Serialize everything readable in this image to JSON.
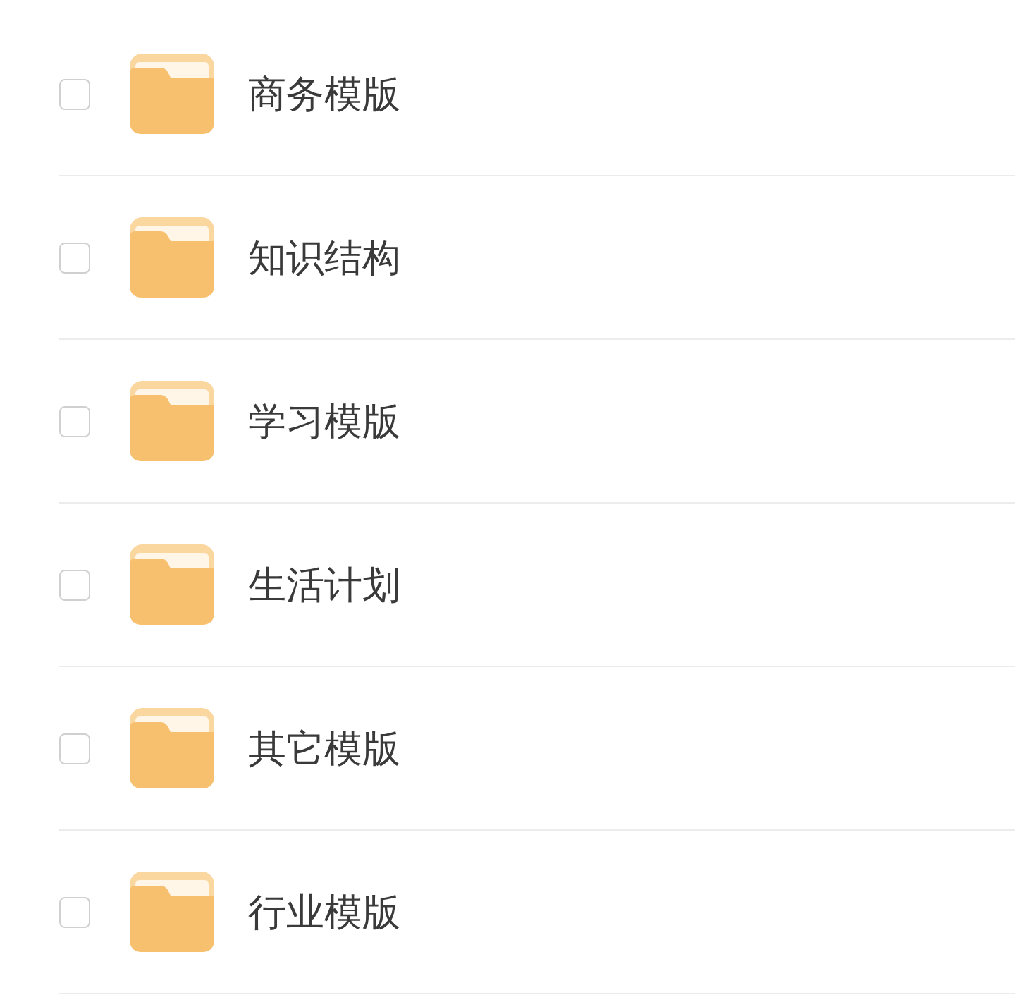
{
  "folders": [
    {
      "name": "商务模版",
      "checked": false
    },
    {
      "name": "知识结构",
      "checked": false
    },
    {
      "name": "学习模版",
      "checked": false
    },
    {
      "name": "生活计划",
      "checked": false
    },
    {
      "name": "其它模版",
      "checked": false
    },
    {
      "name": "行业模版",
      "checked": false
    }
  ]
}
